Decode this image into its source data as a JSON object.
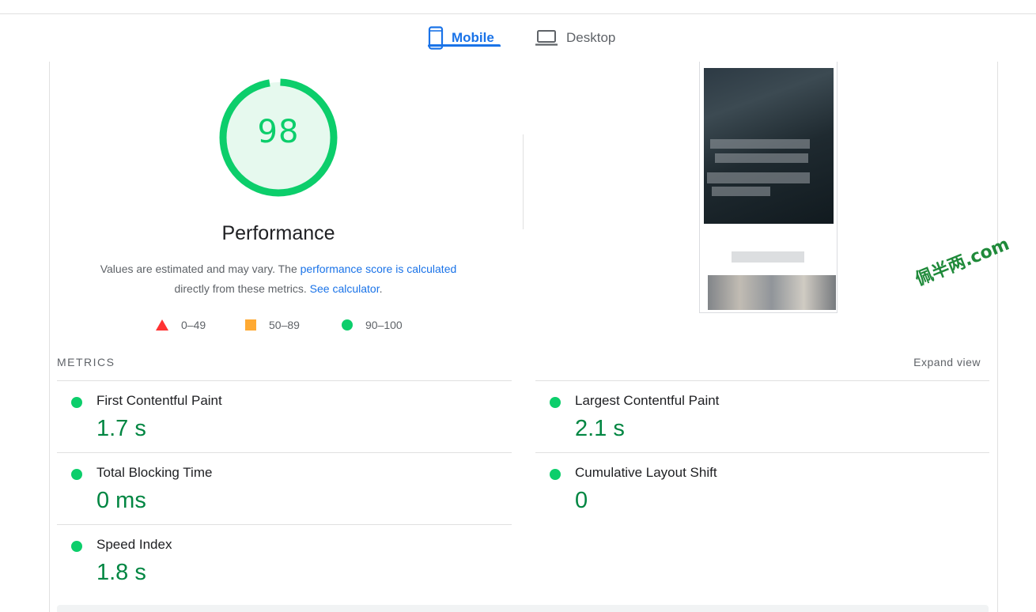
{
  "tabs": {
    "mobile_label": "Mobile",
    "desktop_label": "Desktop",
    "active": "Mobile"
  },
  "gauge": {
    "score": "98",
    "fraction": 0.98,
    "color": "#0cce6b",
    "fill_color": "#e6f9ee"
  },
  "category": {
    "title": "Performance"
  },
  "description": {
    "text_before": "Values are estimated and may vary. The ",
    "link_score": "performance score is calculated",
    "text_middle": "directly from these metrics. ",
    "link_calculator": "See calculator",
    "text_after": "."
  },
  "legend": [
    {
      "range": "0–49",
      "shape": "triangle",
      "color": "#ff3333"
    },
    {
      "range": "50–89",
      "shape": "square",
      "color": "#ffaa33"
    },
    {
      "range": "90–100",
      "shape": "circle",
      "color": "#0cce6b"
    }
  ],
  "metrics_section": {
    "header": "METRICS",
    "expand_label": "Expand view"
  },
  "metrics": [
    {
      "title": "First Contentful Paint",
      "value": "1.7 s"
    },
    {
      "title": "Largest Contentful Paint",
      "value": "2.1 s"
    },
    {
      "title": "Total Blocking Time",
      "value": "0 ms"
    },
    {
      "title": "Cumulative Layout Shift",
      "value": "0"
    },
    {
      "title": "Speed Index",
      "value": "1.8 s"
    }
  ],
  "watermark": "佩半两.com",
  "colors": {
    "accent": "#1a73e8",
    "pass": "#0cce6b",
    "pass_text": "#018642"
  }
}
